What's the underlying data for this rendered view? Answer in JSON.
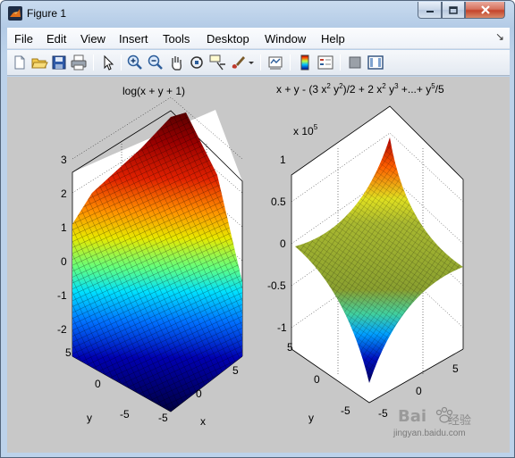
{
  "window": {
    "title": "Figure 1"
  },
  "menu": [
    "File",
    "Edit",
    "View",
    "Insert",
    "Tools",
    "Desktop",
    "Window",
    "Help"
  ],
  "menu_dock_glyph": "↘",
  "toolbar": {
    "buttons": [
      "new-figure-icon",
      "open-file-icon",
      "save-icon",
      "print-icon",
      "edit-plot-icon",
      "zoom-in-icon",
      "zoom-out-icon",
      "pan-icon",
      "rotate-3d-icon",
      "data-cursor-icon",
      "brush-icon",
      "link-plot-icon",
      "colorbar-icon",
      "legend-icon",
      "hide-plot-tools-icon",
      "show-plot-tools-icon"
    ]
  },
  "plots": {
    "left": {
      "title": "log(x + y + 1)",
      "z_ticks": [
        "3",
        "2",
        "1",
        "0",
        "-1",
        "-2"
      ],
      "y_ticks": [
        "5",
        "0",
        "-5"
      ],
      "x_ticks": [
        "-5",
        "0",
        "5"
      ],
      "xlabel": "x",
      "ylabel": "y"
    },
    "right": {
      "title_parts": [
        "x + y - (3 x",
        "2",
        " y",
        "2",
        ")/2 + 2 x",
        "2",
        " y",
        "3",
        " +...+ y",
        "5",
        "/5"
      ],
      "exponent_base": "x 10",
      "exponent_power": "5",
      "z_ticks": [
        "1",
        "0.5",
        "0",
        "-0.5",
        "-1"
      ],
      "y_ticks": [
        "5",
        "0",
        "-5"
      ],
      "x_ticks": [
        "-5",
        "0",
        "5"
      ],
      "ylabel": "y"
    }
  },
  "watermark": {
    "brand": "Bai 经验",
    "url": "jingyan.baidu.com"
  },
  "colors": {
    "figure_bg": "#c8c8c8",
    "axes_bg": "#ffffff"
  }
}
